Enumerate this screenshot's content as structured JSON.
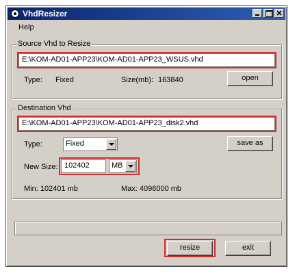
{
  "window": {
    "title": "VhdResizer"
  },
  "menu": {
    "help": "Help"
  },
  "source": {
    "group_label": "Source Vhd to Resize",
    "path": "E:\\KOM-AD01-APP23\\KOM-AD01-APP23_WSUS.vhd",
    "type_label": "Type:",
    "type_value": "Fixed",
    "size_label": "Size(mb):",
    "size_value": "163840",
    "open_button": "open"
  },
  "destination": {
    "group_label": "Destination Vhd",
    "path": "E:\\KOM-AD01-APP23\\KOM-AD01-APP23_disk2.vhd",
    "type_label": "Type:",
    "type_selected": "Fixed",
    "save_as_button": "save as",
    "new_size_label": "New Size:",
    "new_size_value": "102402",
    "unit_selected": "MB",
    "min_text": "Min: 102401 mb",
    "max_text": "Max: 4096000 mb"
  },
  "actions": {
    "resize": "resize",
    "exit": "exit"
  },
  "colors": {
    "highlight": "#d22b2b",
    "titlebar": "#0a246a",
    "face": "#d4d0c8"
  }
}
